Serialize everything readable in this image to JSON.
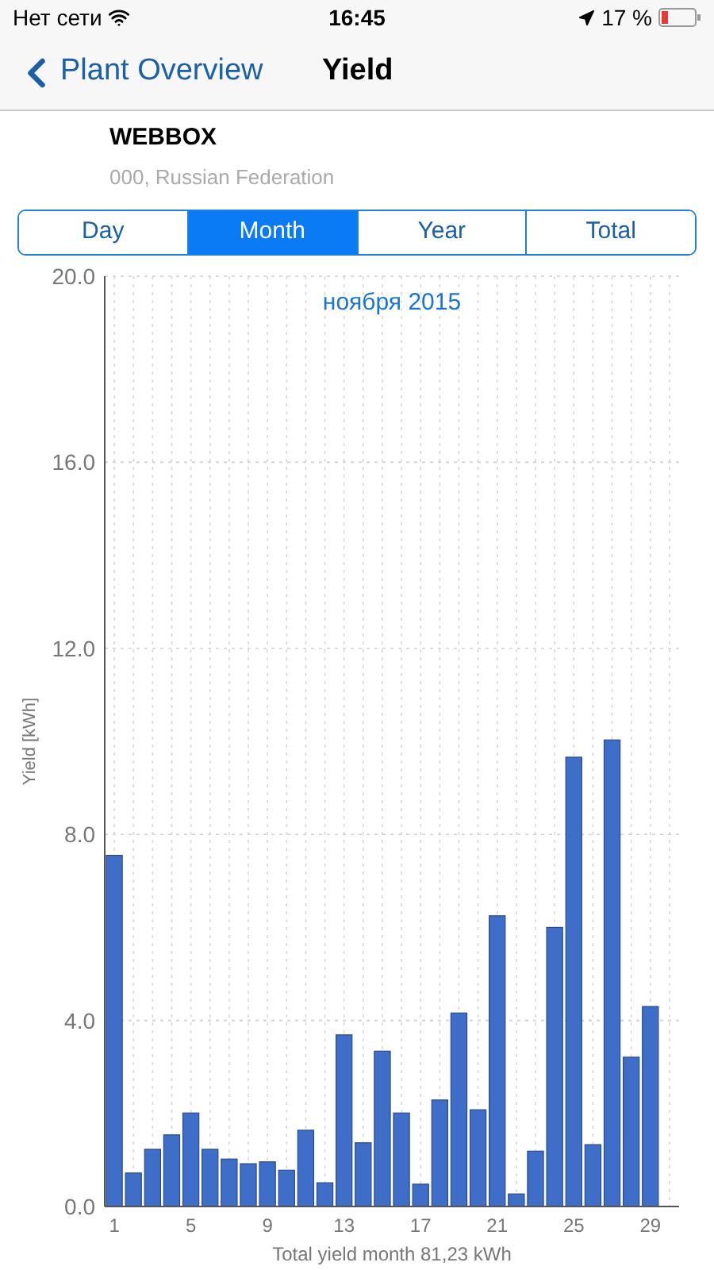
{
  "status_bar": {
    "carrier": "Нет сети",
    "time": "16:45",
    "battery": "17 %"
  },
  "nav": {
    "back": "Plant Overview",
    "title": "Yield"
  },
  "plant": {
    "name": "WEBBOX",
    "location": "000, Russian Federation"
  },
  "tabs": [
    {
      "label": "Day",
      "selected": false
    },
    {
      "label": "Month",
      "selected": true
    },
    {
      "label": "Year",
      "selected": false
    },
    {
      "label": "Total",
      "selected": false
    }
  ],
  "chart_data": {
    "type": "bar",
    "title": "ноября 2015",
    "xlabel": "Total yield month 81,23 kWh",
    "ylabel": "Yield [kWh]",
    "grid": true,
    "x": [
      1,
      2,
      3,
      4,
      5,
      6,
      7,
      8,
      9,
      10,
      11,
      12,
      13,
      14,
      15,
      16,
      17,
      18,
      19,
      20,
      21,
      22,
      23,
      24,
      25,
      26,
      27,
      28,
      29
    ],
    "series": [
      {
        "color": "#3e6ec7",
        "values": [
          7.55,
          0.72,
          1.23,
          1.54,
          2.01,
          1.23,
          1.02,
          0.92,
          0.96,
          0.78,
          1.64,
          0.51,
          3.69,
          1.37,
          3.34,
          2.01,
          0.48,
          2.29,
          4.16,
          2.08,
          6.25,
          0.27,
          1.19,
          6.0,
          9.66,
          1.33,
          10.03,
          3.21,
          4.3
        ]
      }
    ],
    "xlim": [
      0.5,
      30.5
    ],
    "ylim": [
      0,
      20
    ],
    "yticks": [
      {
        "value": 0,
        "label": "0.0"
      },
      {
        "value": 4,
        "label": "4.0"
      },
      {
        "value": 8,
        "label": "8.0"
      },
      {
        "value": 12,
        "label": "12.0"
      },
      {
        "value": 16,
        "label": "16.0"
      },
      {
        "value": 20,
        "label": "20.0"
      }
    ],
    "xticks": [
      1,
      5,
      9,
      13,
      17,
      21,
      25,
      29
    ]
  }
}
